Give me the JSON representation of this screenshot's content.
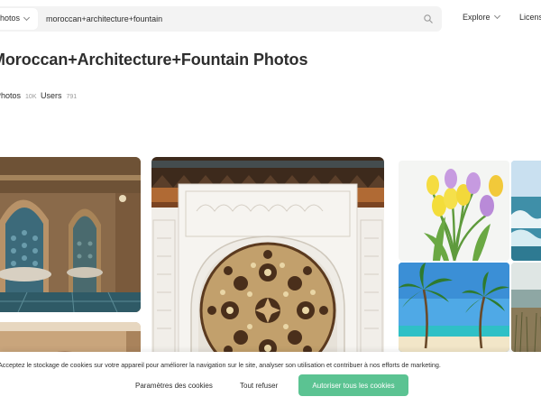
{
  "header": {
    "search_type": "Photos",
    "search_query": "moroccan+architecture+fountain",
    "nav_explore": "Explore",
    "nav_license": "License"
  },
  "page": {
    "title": "Moroccan+Architecture+Fountain Photos",
    "tabs": [
      {
        "label": "Photos",
        "count": "10K"
      },
      {
        "label": "Users",
        "count": "791"
      }
    ]
  },
  "photos": [
    {
      "name": "moroccan-wall-fountain"
    },
    {
      "name": "moroccan-arch"
    },
    {
      "name": "moroccan-white-arch-zellige"
    },
    {
      "name": "tulips"
    },
    {
      "name": "sea-wave"
    },
    {
      "name": "palm-trees-beach"
    },
    {
      "name": "coastal-grass"
    }
  ],
  "cookie_banner": {
    "text": "Acceptez le stockage de cookies sur votre appareil pour améliorer la navigation sur le site, analyser son utilisation et contribuer à nos efforts de marketing.",
    "settings_label": "Paramètres des cookies",
    "refuse_label": "Tout refuser",
    "accept_label": "Autoriser tous les cookies"
  },
  "colors": {
    "accent": "#5bc392",
    "text": "#2e2e2e",
    "search_bg": "#f3f3f3"
  }
}
